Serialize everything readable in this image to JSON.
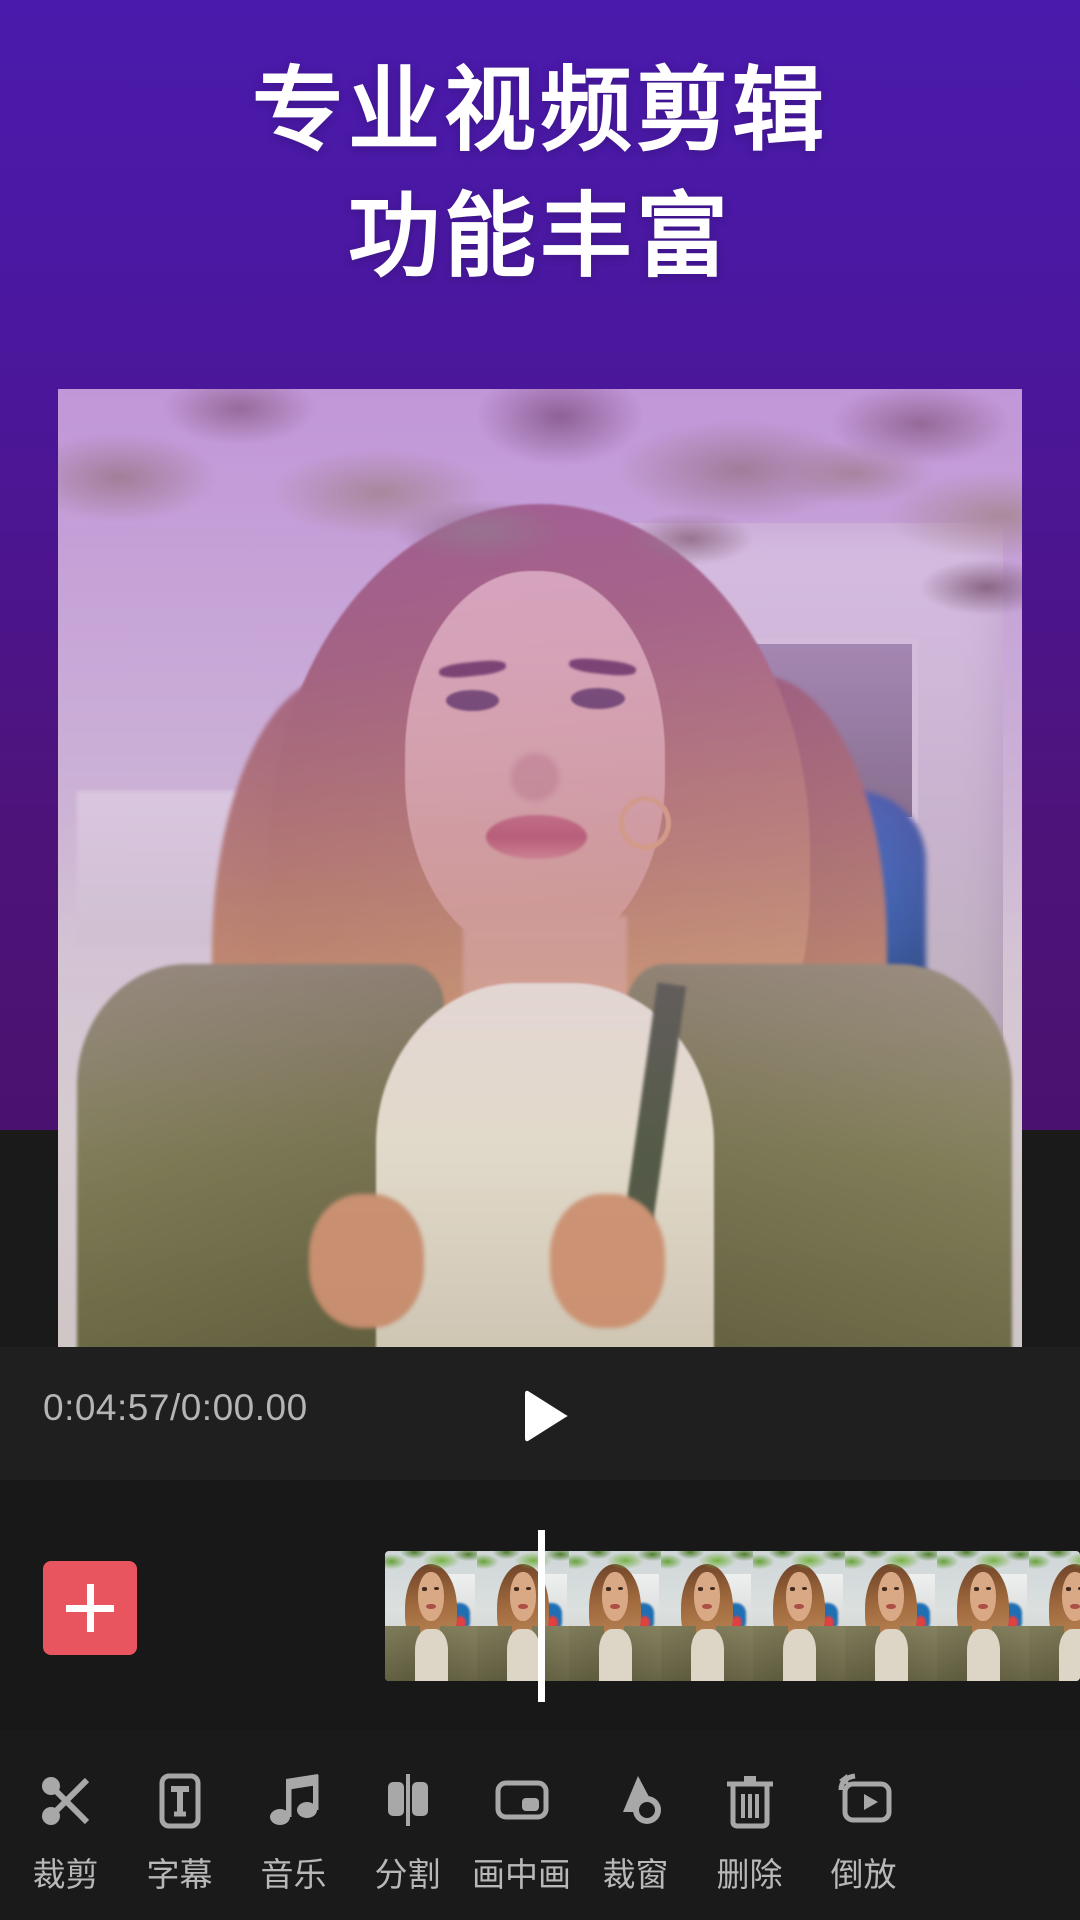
{
  "hero": {
    "title_line1": "专业视频剪辑",
    "title_line2": "功能丰富",
    "gradient_top": "#4A1AAC",
    "gradient_bottom": "#4B1170"
  },
  "preview": {
    "name": "video-preview",
    "tint_color": "#9646BE"
  },
  "player": {
    "timecode": "0:04:57/0:00.00",
    "play_icon": "play-icon"
  },
  "timeline": {
    "add_button_icon": "plus-icon",
    "add_button_color": "#E8555F",
    "playhead_color": "#FFFFFF",
    "frame_count": 8
  },
  "toolbar": {
    "icon_color": "#A8A8A8",
    "label_color": "#B8B8B8",
    "items": [
      {
        "label": "裁剪",
        "icon": "scissors-icon"
      },
      {
        "label": "字幕",
        "icon": "text-box-icon"
      },
      {
        "label": "音乐",
        "icon": "music-note-icon"
      },
      {
        "label": "分割",
        "icon": "split-icon"
      },
      {
        "label": "画中画",
        "icon": "picture-in-picture-icon"
      },
      {
        "label": "裁窗",
        "icon": "crop-window-icon"
      },
      {
        "label": "删除",
        "icon": "trash-icon"
      },
      {
        "label": "倒放",
        "icon": "reverse-play-icon"
      }
    ]
  }
}
